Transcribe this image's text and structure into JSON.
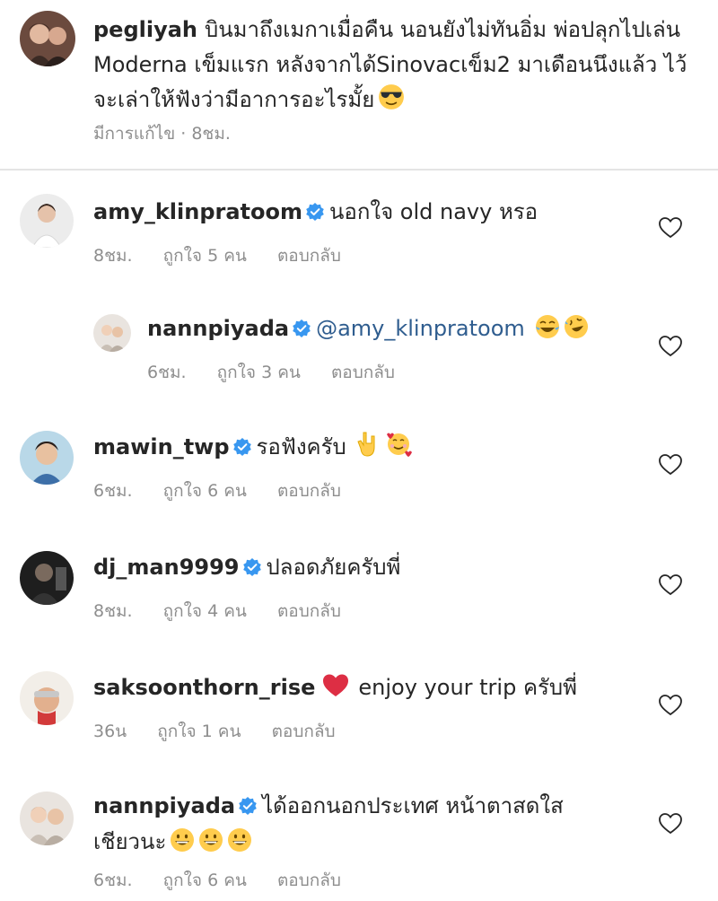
{
  "caption": {
    "username": "pegliyah",
    "text": "บินมาถึงเมกาเมื่อคืน นอนยังไม่ทันอิ่ม พ่อปลุกไปเล่น Moderna เข็มแรก หลังจากได้Sinovacเข็ม2 มาเดือนนึงแล้ว ไว้จะเล่าให้ฟังว่ามีอาการอะไรมั้ย",
    "emoji_icon": "sunglasses-face-icon",
    "edited": "มีการแก้ไข",
    "separator": "·",
    "time": "8ชม."
  },
  "labels": {
    "likes_prefix": "ถูกใจ",
    "likes_suffix": "คน",
    "reply": "ตอบกลับ"
  },
  "comments": [
    {
      "username": "amy_klinpratoom",
      "verified": true,
      "text": "นอกใจ old navy หรอ",
      "time": "8ชม.",
      "likes": "5",
      "likes_label": "ถูกใจ 5 คน"
    },
    {
      "username": "nannpiyada",
      "verified": true,
      "mention": "@amy_klinpratoom",
      "emojis": [
        "tears-of-joy-icon",
        "rolling-laughing-icon"
      ],
      "time": "6ชม.",
      "likes": "3",
      "likes_label": "ถูกใจ 3 คน",
      "is_reply": true
    },
    {
      "username": "mawin_twp",
      "verified": true,
      "text": "รอฟังครับ",
      "emojis": [
        "love-you-gesture-icon",
        "smiling-face-with-hearts-icon"
      ],
      "time": "6ชม.",
      "likes": "6",
      "likes_label": "ถูกใจ 6 คน"
    },
    {
      "username": "dj_man9999",
      "verified": true,
      "text": "ปลอดภัยครับพี่",
      "time": "8ชม.",
      "likes": "4",
      "likes_label": "ถูกใจ 4 คน"
    },
    {
      "username": "saksoonthorn_rise",
      "verified": false,
      "text": "enjoy your trip ครับพี่",
      "emojis": [
        "red-heart-icon"
      ],
      "time": "36น",
      "likes": "1",
      "likes_label": "ถูกใจ 1 คน"
    },
    {
      "username": "nannpiyada",
      "verified": true,
      "text": "ได้ออกนอกประเทศ หน้าตาสดใสเชียวนะ",
      "emojis": [
        "grinning-face-icon",
        "grinning-face-icon",
        "grinning-face-icon"
      ],
      "time": "6ชม.",
      "likes": "6",
      "likes_label": "ถูกใจ 6 คน"
    }
  ],
  "colors": {
    "verified": "#3897f0",
    "meta_text": "#8e8e8e",
    "mention": "#2f5d8f",
    "divider": "#e4e4e4"
  }
}
